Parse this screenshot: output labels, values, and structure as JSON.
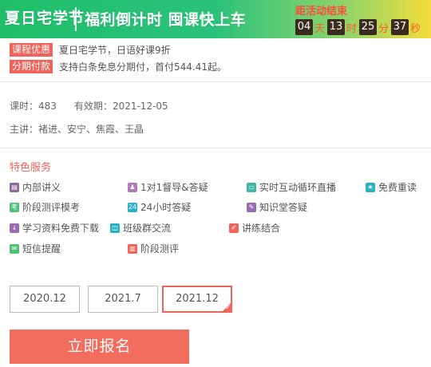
{
  "banner": {
    "logo": "夏日宅学节",
    "slogan": "福利倒计时 囤课快上车",
    "countdown_title": "距活动结束",
    "countdown": [
      {
        "value": "04",
        "unit": "天"
      },
      {
        "value": "13",
        "unit": "时"
      },
      {
        "value": "25",
        "unit": "分"
      },
      {
        "value": "37",
        "unit": "秒"
      }
    ]
  },
  "promos": [
    {
      "tag": "课程优惠",
      "text": "夏日宅学节，日语好课9折"
    },
    {
      "tag": "分期付款",
      "text": "支持白条免息分期付，首付544.41起。"
    }
  ],
  "course": {
    "hours_label": "课时：",
    "hours": "483",
    "validity_label": "有效期：",
    "validity": "2021-12-05",
    "teachers_label": "主讲：",
    "teachers": "褚进、安宁、焦霞、王晶"
  },
  "services": {
    "title": "特色服务",
    "items": [
      {
        "label": "内部讲义",
        "icon": "document-icon",
        "color": "#8a6b9a"
      },
      {
        "label": "1对1督导&答疑",
        "icon": "person-icon",
        "color": "#b07ab5"
      },
      {
        "label": "实时互动循环直播",
        "icon": "monitor-icon",
        "color": "#3fb7a3"
      },
      {
        "label": "免费重读",
        "icon": "star-icon",
        "color": "#2bb0c5"
      },
      {
        "label": "阶段测评模考",
        "icon": "exam-icon",
        "color": "#4fbf7a"
      },
      {
        "label": "24小时答疑",
        "icon": "clock-24-icon",
        "color": "#2bb0c5"
      },
      {
        "label": "知识堂答疑",
        "icon": "chat-icon",
        "color": "#9a6bb0"
      },
      {
        "label": "学习资料免费下载",
        "icon": "download-icon",
        "color": "#9a6bb0"
      },
      {
        "label": "班级群交流",
        "icon": "group-icon",
        "color": "#2bb0c5"
      },
      {
        "label": "讲练结合",
        "icon": "pencil-icon",
        "color": "#f0625a"
      },
      {
        "label": "短信提醒",
        "icon": "message-icon",
        "color": "#4fbf7a"
      },
      {
        "label": "阶段测评",
        "icon": "chart-icon",
        "color": "#f0625a"
      }
    ]
  },
  "dates": [
    "2020.12",
    "2021.7",
    "2021.12"
  ],
  "selected_date": "2021.12",
  "enroll_label": "立即报名"
}
